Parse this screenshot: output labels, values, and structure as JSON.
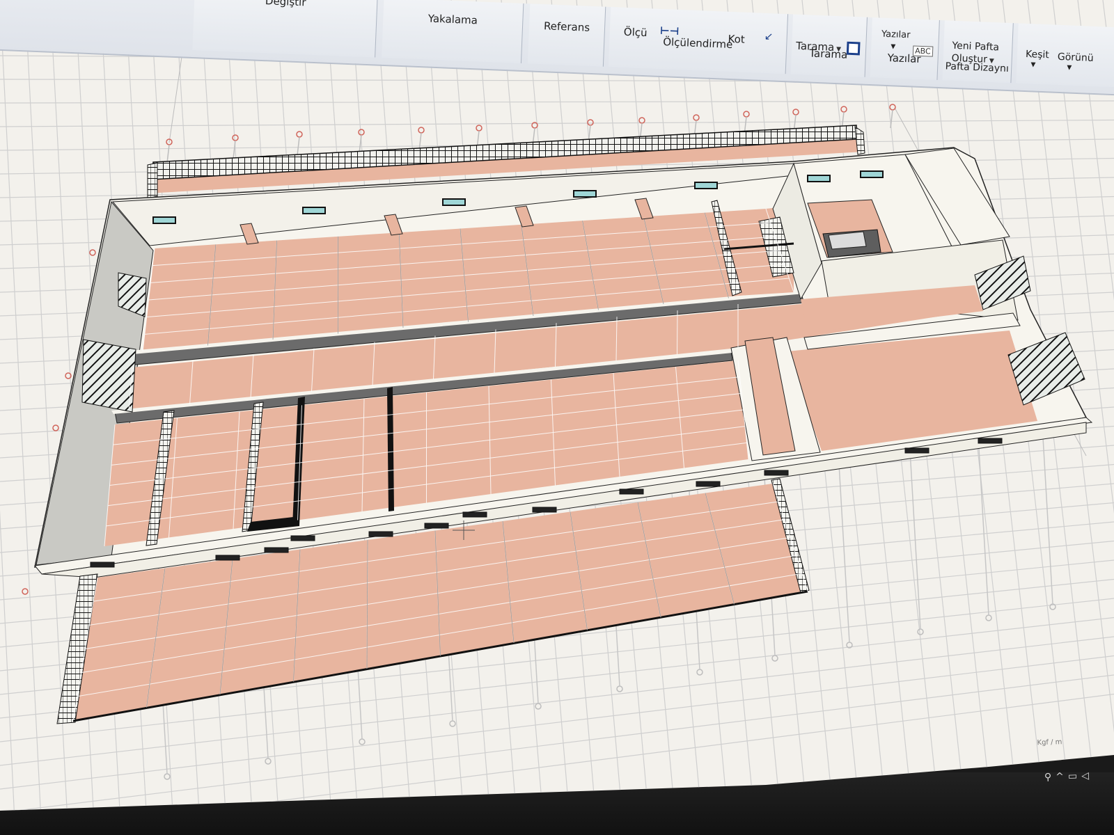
{
  "ribbon": {
    "groups": [
      {
        "label": "Değiştir"
      },
      {
        "label": "Yakalama"
      },
      {
        "label": "Referans"
      },
      {
        "label": "Ölçülendirme"
      },
      {
        "label": "Tarama"
      },
      {
        "label": "Yazılar"
      },
      {
        "label": "Pafta Dizaynı"
      }
    ],
    "commands": {
      "olcu": "Ölçü",
      "kot": "Kot",
      "tarama": "Tarama",
      "yazilar": "Yazılar",
      "yeni_pafta_1": "Yeni Pafta",
      "yeni_pafta_2": "Oluştur",
      "kesit": "Keşit",
      "gorunum": "Görünü"
    },
    "icons": [
      "dimension-icon",
      "level-icon",
      "hatch-square-icon",
      "text-abc-icon"
    ]
  },
  "statusbar": {
    "unit": "Kgf / m"
  },
  "viewport": {
    "view": "3d-plan-perspective",
    "colors": {
      "background": "#f3f1ec",
      "grid": "#cfcfcf",
      "floor": "#e8b59f",
      "floor_lines": "#ffffff",
      "wall_top": "#f7f5ee",
      "wall_side": "#c9c9c4",
      "outline": "#222222",
      "axis_marker": "#d0645a"
    }
  }
}
